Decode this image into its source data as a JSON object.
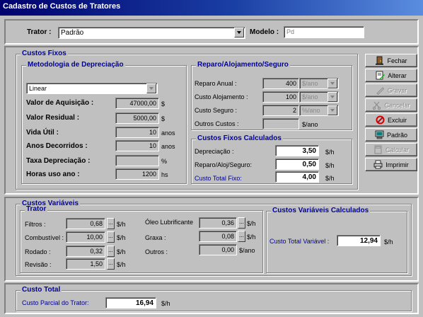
{
  "window": {
    "title": "Cadastro de Custos de Tratores"
  },
  "header": {
    "trator_label": "Trator :",
    "trator_value": "Padrão",
    "modelo_label": "Modelo :",
    "modelo_value": "Pd"
  },
  "custos_fixos": {
    "title": "Custos Fixos",
    "metodologia": {
      "title": "Metodologia de Depreciação",
      "method_value": "Linear",
      "rows": [
        {
          "label": "Valor de Aquisição :",
          "value": "47000,00",
          "unit": "$"
        },
        {
          "label": "Valor Residual :",
          "value": "5000,00",
          "unit": "$"
        },
        {
          "label": "Vida Útil :",
          "value": "10",
          "unit": "anos"
        },
        {
          "label": "Anos Decorridos :",
          "value": "10",
          "unit": "anos"
        },
        {
          "label": "Taxa Depreciação :",
          "value": "",
          "unit": "%"
        },
        {
          "label": "Horas uso ano :",
          "value": "1200",
          "unit": "hs"
        }
      ]
    },
    "reparo": {
      "title": "Reparo/Alojamento/Seguro",
      "rows": [
        {
          "label": "Reparo Anual :",
          "value": "400",
          "unit": "$/ano"
        },
        {
          "label": "Custo Alojamento :",
          "value": "100",
          "unit": "$/ano"
        },
        {
          "label": "Custo Seguro :",
          "value": "2",
          "unit": "%/ano"
        },
        {
          "label": "Outros Custos :",
          "value": "",
          "unit": "$/ano"
        }
      ]
    },
    "calculados": {
      "title": "Custos Fixos Calculados",
      "rows": [
        {
          "label": "Depreciação :",
          "value": "3,50",
          "unit": "$/h"
        },
        {
          "label": "Reparo/Aloj/Seguro:",
          "value": "0,50",
          "unit": "$/h"
        },
        {
          "label": "Custo Total Fixo:",
          "value": "4,00",
          "unit": "$/h"
        }
      ]
    }
  },
  "buttons": {
    "fechar": "Fechar",
    "alterar": "Alterar",
    "gravar": "Gravar",
    "cancelar": "Cancelar",
    "excluir": "Excluir",
    "padrao": "Padrão",
    "calcular": "Calcular",
    "imprimir": "Imprimir"
  },
  "custos_variaveis": {
    "title": "Custos Variáveis",
    "trator_title": "Trator",
    "left_rows": [
      {
        "label": "Filtros :",
        "value": "0,68",
        "unit": "$/h"
      },
      {
        "label": "Combustível :",
        "value": "10,00",
        "unit": "$/h"
      },
      {
        "label": "Rodado :",
        "value": "0,32",
        "unit": "$/h"
      },
      {
        "label": "Revisão :",
        "value": "1,50",
        "unit": "$/h"
      }
    ],
    "right_rows": [
      {
        "label": "Óleo Lubrificante",
        "value": "0,36",
        "unit": "$/h"
      },
      {
        "label": "Graxa :",
        "value": "0,08",
        "unit": "$/h"
      },
      {
        "label": "Outros :",
        "value": "0,00",
        "unit": "$/ano"
      }
    ],
    "calculados": {
      "title": "Custos  Variáveis Calculados",
      "label": "Custo Total Variável :",
      "value": "12,94",
      "unit": "$/h"
    }
  },
  "custo_total": {
    "title": "Custo Total",
    "label": "Custo Parcial do Trator:",
    "value": "16,94",
    "unit": "$/h"
  },
  "colors": {
    "title_bar_start": "#00006e",
    "title_bar_end": "#5a8de0",
    "group_title": "#0000a0",
    "face": "#c0c0c0"
  }
}
